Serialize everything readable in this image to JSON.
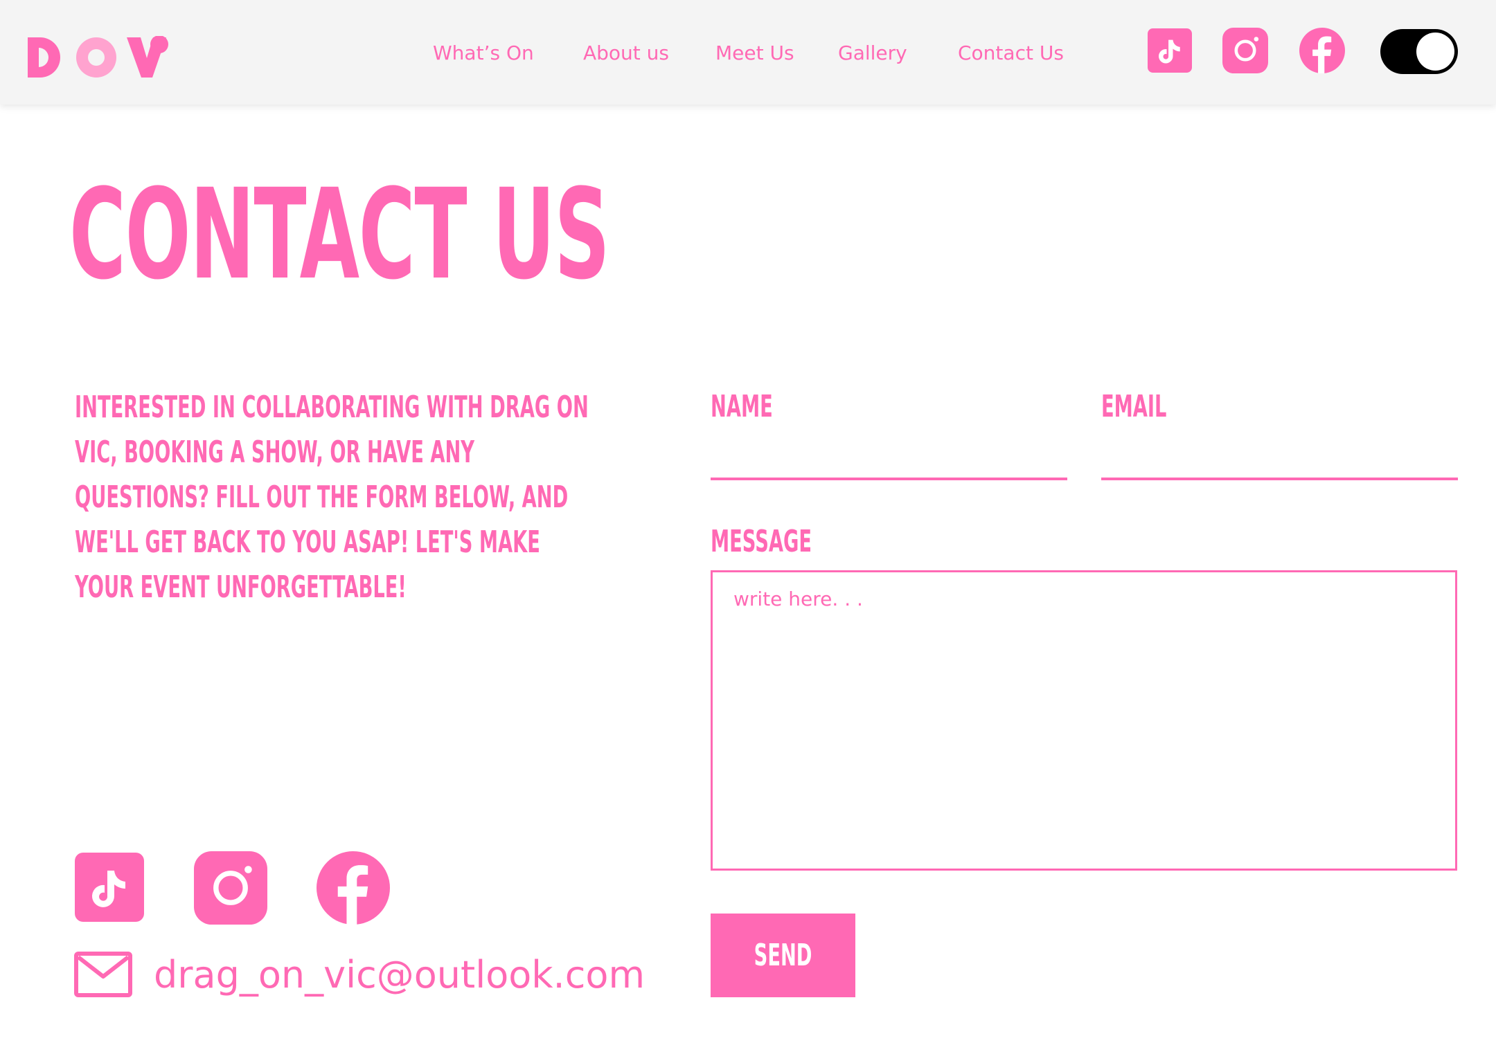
{
  "brand": {
    "logo_text": "DOV",
    "accent_color": "#ff69b4",
    "logo_light_color": "#ffa3cf"
  },
  "nav": {
    "links": [
      "What’s On",
      "About us",
      "Meet Us",
      "Gallery",
      "Contact Us"
    ],
    "social_icons": [
      "tiktok-icon",
      "instagram-icon",
      "facebook-icon"
    ],
    "theme_toggle": {
      "state": "on",
      "track_color": "#000000"
    }
  },
  "page": {
    "title": "CONTACT US",
    "intro": "Interested in collaborating with Drag On Vic, booking a show, or have any questions? Fill out the form below, and we'll get back to you ASAP! Let's make your event unforgettable!"
  },
  "form": {
    "name_label": "NAME",
    "name_value": "",
    "email_label": "EMAIL",
    "email_value": "",
    "message_label": "MESSAGE",
    "message_placeholder": "write here. . .",
    "send_label": "SEND"
  },
  "contact": {
    "social_icons": [
      "tiktok-icon",
      "instagram-icon",
      "facebook-icon"
    ],
    "email": "drag_on_vic@outlook.com"
  }
}
